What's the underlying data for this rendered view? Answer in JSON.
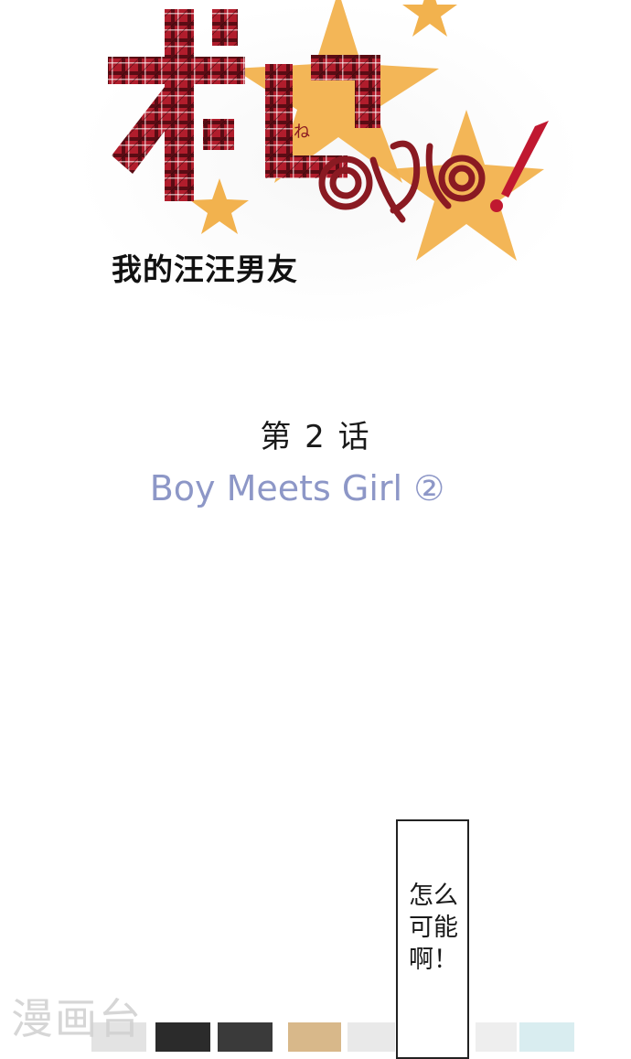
{
  "logo": {
    "subtitle": "我的汪汪男友",
    "small_glyph": "ね",
    "colors": {
      "plaid": "#b11d2c",
      "plaid_dark": "#3a0a0e",
      "star": "#f2b24e",
      "script": "#8a1a22"
    }
  },
  "chapter": {
    "number": "第 2 话",
    "title": "Boy Meets Girl ②",
    "title_color": "#8d97c7"
  },
  "speech_bubble": {
    "text": "怎么\n可能\n啊！"
  },
  "watermark": {
    "text": "漫画台"
  }
}
